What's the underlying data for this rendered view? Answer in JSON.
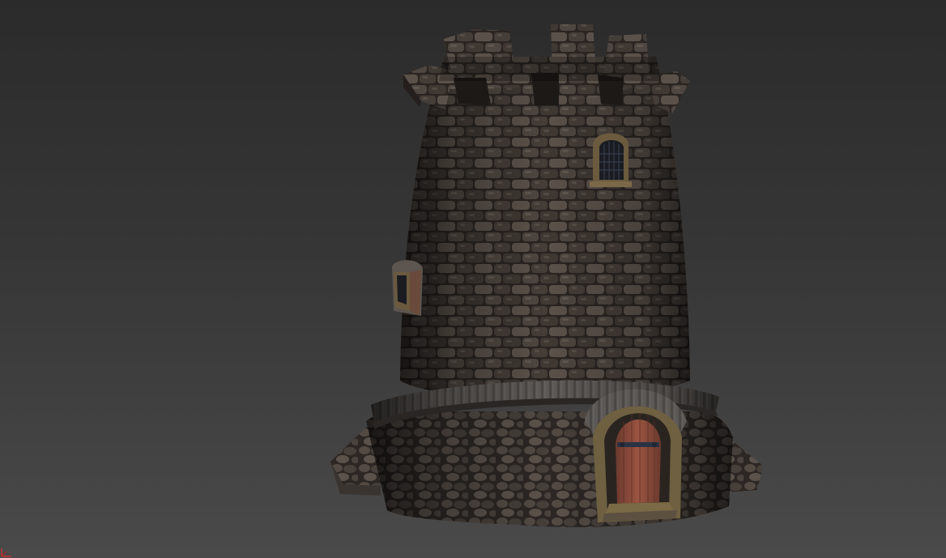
{
  "viewport": {
    "background_top": "#2b2b2b",
    "background_bottom": "#4a4a4a",
    "model": "stone-tower",
    "gizmo_color": "#e03030"
  },
  "colors": {
    "stone_dark": "#2f2a27",
    "stone_mid": "#4a423d",
    "stone_light": "#6b615a",
    "mortar": "#221e1b",
    "roof_tiles": "#5a5552",
    "door_wood": "#8a4a3a",
    "door_frame": "#7a6a45",
    "hinge": "#2a3344"
  }
}
